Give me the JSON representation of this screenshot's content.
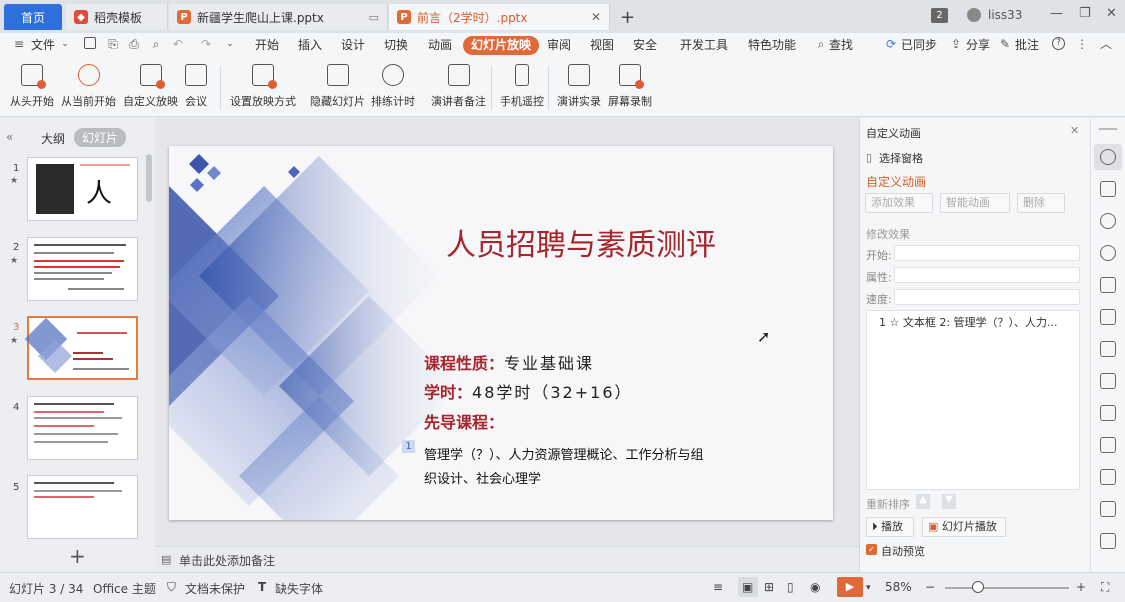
{
  "tabs": {
    "home": "首页",
    "template": "稻壳模板",
    "file1": "新疆学生爬山上课.pptx",
    "file2": "前言（2学时）.pptx",
    "new_tab": "+"
  },
  "window": {
    "user_badge": "2",
    "username": "liss33"
  },
  "menubar": {
    "file": "文件",
    "items": [
      "开始",
      "插入",
      "设计",
      "切换",
      "动画",
      "幻灯片放映",
      "审阅",
      "视图",
      "安全",
      "开发工具",
      "特色功能"
    ],
    "search": "查找",
    "sync": "已同步",
    "share": "分享",
    "comment": "批注"
  },
  "ribbon": {
    "buttons": [
      "从头开始",
      "从当前开始",
      "自定义放映",
      "会议",
      "设置放映方式",
      "隐藏幻灯片",
      "排练计时",
      "演讲者备注",
      "手机遥控",
      "演讲实录",
      "屏幕录制"
    ]
  },
  "leftpanel": {
    "outline": "大纲",
    "slides": "幻灯片",
    "numbers": [
      "1",
      "2",
      "3",
      "4",
      "5"
    ],
    "add": "+"
  },
  "slide": {
    "title": "人员招聘与素质测评",
    "line1_label": "课程性质：",
    "line1_value": "专业基础课",
    "line2_label": "学时：",
    "line2_value": "48学时（32+16）",
    "line3_label": "先导课程：",
    "anim_marker": "1",
    "body_line1": "管理学（？）、人力资源管理概论、工作分析与组",
    "body_line2": "织设计、社会心理学"
  },
  "notes": {
    "placeholder": "单击此处添加备注"
  },
  "rightpanel": {
    "title": "自定义动画",
    "select_pane": "选择窗格",
    "section": "自定义动画",
    "add_effect": "添加效果",
    "smart_anim": "智能动画",
    "delete": "删除",
    "modify": "修改效果",
    "start": "开始:",
    "property": "属性:",
    "speed": "速度:",
    "list_item": "1 ☆ 文本框 2: 管理学（？）、人力...",
    "reorder": "重新排序",
    "play": "播放",
    "slideshow": "幻灯片播放",
    "autopreview": "自动预览"
  },
  "statusbar": {
    "slide_count": "幻灯片 3 / 34",
    "theme": "Office 主题",
    "protect": "文档未保护",
    "missing_font": "缺失字体",
    "zoom": "58%"
  },
  "colors": {
    "accent": "#e06a37",
    "title_red": "#a5262c",
    "home_blue": "#2f6fdb"
  }
}
